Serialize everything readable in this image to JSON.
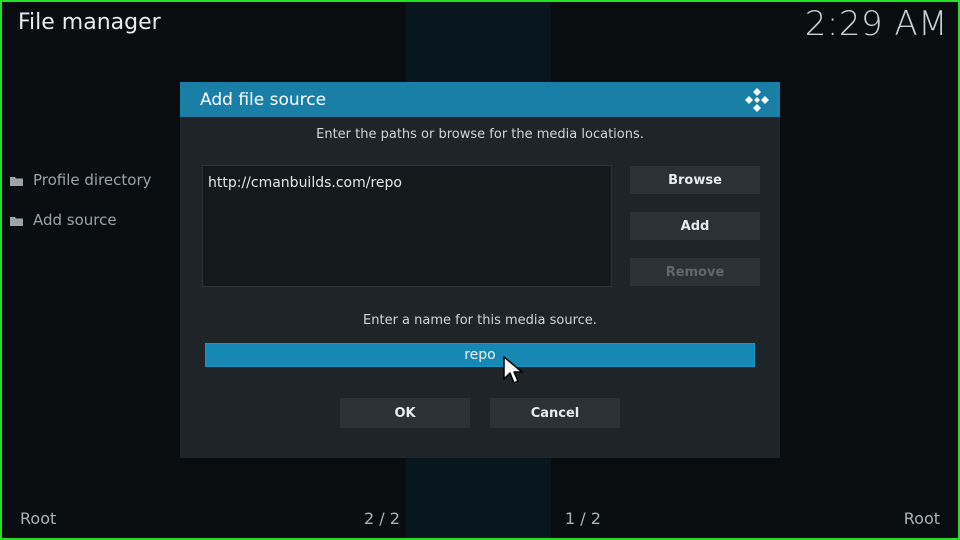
{
  "app": {
    "title": "File manager",
    "clock": "2:29 AM"
  },
  "sidebar": {
    "items": [
      {
        "label": "Profile directory"
      },
      {
        "label": "Add source"
      }
    ]
  },
  "footer": {
    "left": "Root",
    "left_count": "2 / 2",
    "right_count": "1 / 2",
    "right": "Root"
  },
  "dialog": {
    "title": "Add file source",
    "paths_instruction": "Enter the paths or browse for the media locations.",
    "paths": [
      "http://cmanbuilds.com/repo"
    ],
    "browse_label": "Browse",
    "add_label": "Add",
    "remove_label": "Remove",
    "name_instruction": "Enter a name for this media source.",
    "name_value": "repo",
    "ok_label": "OK",
    "cancel_label": "Cancel"
  },
  "colors": {
    "accent": "#1a7fa7",
    "input_highlight": "#1688b3",
    "frame": "#22e122"
  },
  "icons": {
    "logo": "kodi-logo-icon",
    "folder": "folder-icon",
    "cursor": "mouse-pointer-icon"
  }
}
